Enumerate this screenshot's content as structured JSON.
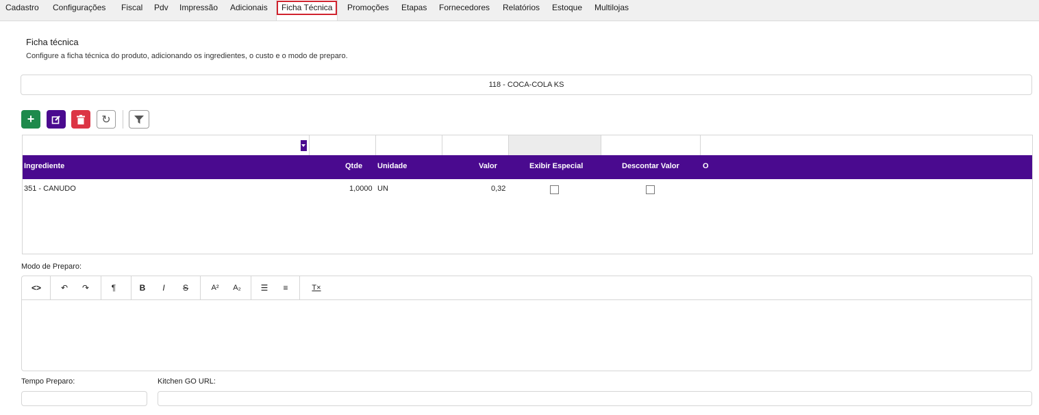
{
  "tabs": [
    "Cadastro",
    "Configurações",
    "Fiscal",
    "Pdv",
    "Impressão",
    "Adicionais",
    "Ficha Técnica",
    "Promoções",
    "Etapas",
    "Fornecedores",
    "Relatórios",
    "Estoque",
    "Multilojas"
  ],
  "page": {
    "title": "Ficha técnica",
    "subtitle": "Configure a ficha técnica do produto, adicionando os ingredientes, o custo e o modo de preparo.",
    "product": "118 - COCA-COLA KS"
  },
  "toolbar": {
    "add_icon": "plus-icon",
    "edit_icon": "edit-icon",
    "delete_icon": "trash-icon",
    "refresh_icon": "refresh-icon",
    "filter_icon": "filter-icon",
    "colors": {
      "add": "#1e8a4c",
      "edit": "#4a0a8f",
      "delete": "#dc3545"
    }
  },
  "grid": {
    "columns": [
      "Ingrediente",
      "Qtde",
      "Unidade",
      "Valor",
      "Exibir Especial",
      "Descontar Valor",
      "O"
    ],
    "rows": [
      {
        "ingrediente": "351 - CANUDO",
        "qtde": "1,0000",
        "unidade": "UN",
        "valor": "0,32",
        "exibir_especial": false,
        "descontar_valor": false
      }
    ],
    "header_color": "#4a0a8f"
  },
  "editor": {
    "label": "Modo de Preparo:",
    "tools": {
      "code": "<>",
      "undo": "↶",
      "redo": "↷",
      "paragraph": "¶",
      "bold": "B",
      "italic": "I",
      "strike": "S",
      "superscript": "A²",
      "subscript": "A₂",
      "ul": "☰",
      "ol": "≡",
      "clear": "T×"
    }
  },
  "fields": {
    "tempo_label": "Tempo Preparo:",
    "kitchen_label": "Kitchen GO URL:"
  }
}
